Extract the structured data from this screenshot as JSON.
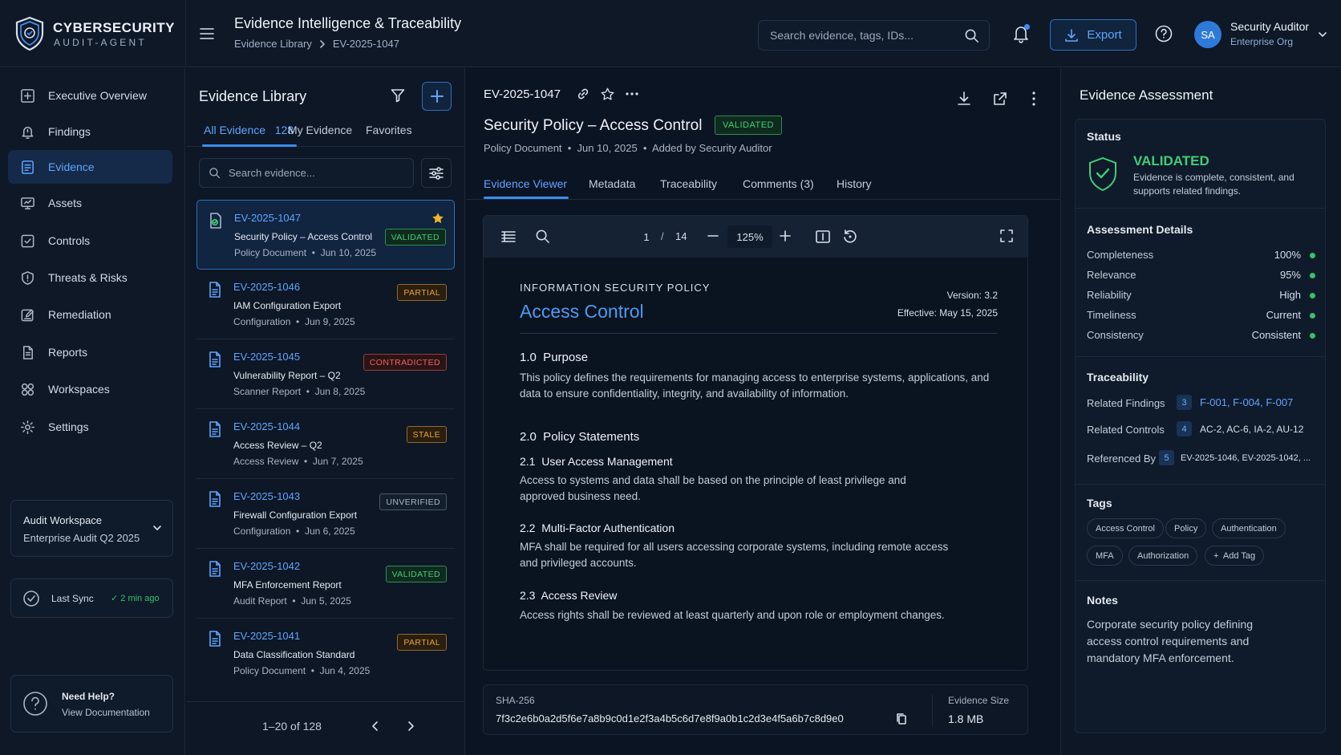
{
  "brand": {
    "name": "CYBERSECURITY",
    "sub": "AUDIT-AGENT"
  },
  "header": {
    "title": "Evidence Intelligence & Traceability",
    "breadcrumb": [
      "Evidence Library",
      "EV-2025-1047"
    ],
    "search_placeholder": "Search evidence, tags, IDs...",
    "export_label": "Export",
    "user": {
      "initials": "SA",
      "name": "Security Auditor",
      "org": "Enterprise Org"
    }
  },
  "sidebar": {
    "items": [
      {
        "label": "Executive Overview",
        "icon": "plus-square-icon",
        "active": false
      },
      {
        "label": "Findings",
        "icon": "bell-alert-icon",
        "active": false
      },
      {
        "label": "Evidence",
        "icon": "evidence-doc-icon",
        "active": true
      },
      {
        "label": "Assets",
        "icon": "monitor-icon",
        "active": false
      },
      {
        "label": "Controls",
        "icon": "checkbox-icon",
        "active": false
      },
      {
        "label": "Threats & Risks",
        "icon": "shield-alert-icon",
        "active": false
      },
      {
        "label": "Remediation",
        "icon": "edit-icon",
        "active": false
      },
      {
        "label": "Reports",
        "icon": "report-icon",
        "active": false
      },
      {
        "label": "Workspaces",
        "icon": "grid-icon",
        "active": false
      },
      {
        "label": "Settings",
        "icon": "gear-icon",
        "active": false
      }
    ],
    "workspace": {
      "title": "Audit Workspace",
      "value": "Enterprise Audit Q2 2025"
    },
    "sync": {
      "label": "Last Sync",
      "value": "✓ 2 min ago"
    },
    "help": {
      "title": "Need Help?",
      "link": "View Documentation"
    }
  },
  "library": {
    "title": "Evidence Library",
    "tabs": [
      {
        "label": "All Evidence",
        "count": "128"
      },
      {
        "label": "My Evidence"
      },
      {
        "label": "Favorites"
      }
    ],
    "search_placeholder": "Search evidence...",
    "items": [
      {
        "id": "EV-2025-1047",
        "title": "Security Policy – Access Control",
        "type": "Policy Document",
        "date": "Jun 10, 2025",
        "status": "VALIDATED",
        "badge": "validated",
        "starred": true,
        "selected": true
      },
      {
        "id": "EV-2025-1046",
        "title": "IAM Configuration Export",
        "type": "Configuration",
        "date": "Jun 9, 2025",
        "status": "PARTIAL",
        "badge": "partial"
      },
      {
        "id": "EV-2025-1045",
        "title": "Vulnerability Report – Q2",
        "type": "Scanner Report",
        "date": "Jun 8, 2025",
        "status": "CONTRADICTED",
        "badge": "contradicted"
      },
      {
        "id": "EV-2025-1044",
        "title": "Access Review – Q2",
        "type": "Access Review",
        "date": "Jun 7, 2025",
        "status": "STALE",
        "badge": "stale"
      },
      {
        "id": "EV-2025-1043",
        "title": "Firewall Configuration Export",
        "type": "Configuration",
        "date": "Jun 6, 2025",
        "status": "UNVERIFIED",
        "badge": "unverified"
      },
      {
        "id": "EV-2025-1042",
        "title": "MFA Enforcement Report",
        "type": "Audit Report",
        "date": "Jun 5, 2025",
        "status": "VALIDATED",
        "badge": "validated"
      },
      {
        "id": "EV-2025-1041",
        "title": "Data Classification Standard",
        "type": "Policy Document",
        "date": "Jun 4, 2025",
        "status": "PARTIAL",
        "badge": "partial"
      }
    ],
    "pagination": "1–20 of 128"
  },
  "main": {
    "evidence_id": "EV-2025-1047",
    "title": "Security Policy – Access Control",
    "status": "VALIDATED",
    "meta": "Policy Document  •  Jun 10, 2025  •  Added by Security Auditor",
    "tabs": [
      "Evidence Viewer",
      "Metadata",
      "Traceability",
      "Comments (3)",
      "History"
    ],
    "viewer": {
      "page": "1",
      "sep": "/",
      "total": "14",
      "zoom": "125%"
    },
    "document": {
      "header": "INFORMATION SECURITY POLICY",
      "title": "Access Control",
      "version": "Version: 3.2",
      "effective": "Effective: May 15, 2025",
      "s1_heading": "1.0  Purpose",
      "s1_body": "This policy defines the requirements for managing access to enterprise systems, applications, and data to ensure confidentiality, integrity, and availability of information.",
      "s2_heading": "2.0  Policy Statements",
      "s21_heading": "2.1  User Access Management",
      "s21_body": "Access to systems and data shall be based on the principle of least privilege and approved business need.",
      "s22_heading": "2.2  Multi-Factor Authentication",
      "s22_body": "MFA shall be required for all users accessing corporate systems, including remote access and privileged accounts.",
      "s23_heading": "2.3  Access Review",
      "s23_body": "Access rights shall be reviewed at least quarterly and upon role or employment changes."
    },
    "hash_label": "SHA-256",
    "hash_value": "7f3c2e6b0a2d5f6e7a8b9c0d1e2f3a4b5c6d7e8f9a0b1c2d3e4f5a6b7c8d9e0",
    "size_label": "Evidence Size",
    "size_value": "1.8 MB"
  },
  "assessment": {
    "title": "Evidence Assessment",
    "status_label": "Status",
    "status_value": "VALIDATED",
    "status_desc": "Evidence is complete, consistent, and supports related findings.",
    "details_label": "Assessment Details",
    "details": [
      {
        "label": "Completeness",
        "value": "100%"
      },
      {
        "label": "Relevance",
        "value": "95%"
      },
      {
        "label": "Reliability",
        "value": "High"
      },
      {
        "label": "Timeliness",
        "value": "Current"
      },
      {
        "label": "Consistency",
        "value": "Consistent"
      }
    ],
    "traceability_label": "Traceability",
    "traceability": [
      {
        "label": "Related Findings",
        "count": "3",
        "value": "F-001, F-004, F-007"
      },
      {
        "label": "Related Controls",
        "count": "4",
        "value": "AC-2, AC-6, IA-2, AU-12"
      },
      {
        "label": "Referenced By",
        "count": "5",
        "value": "EV-2025-1046, EV-2025-1042, ..."
      }
    ],
    "tags_label": "Tags",
    "tags": [
      "Access Control",
      "Policy",
      "Authentication",
      "MFA",
      "Authorization"
    ],
    "add_tag": "+  Add Tag",
    "notes_label": "Notes",
    "notes": "Corporate security policy defining access control requirements and mandatory MFA enforcement."
  },
  "colors": {
    "accent": "#3b8ef0",
    "validated": "#3fcf76",
    "partial": "#e8a33b",
    "contradicted": "#f2625d"
  }
}
